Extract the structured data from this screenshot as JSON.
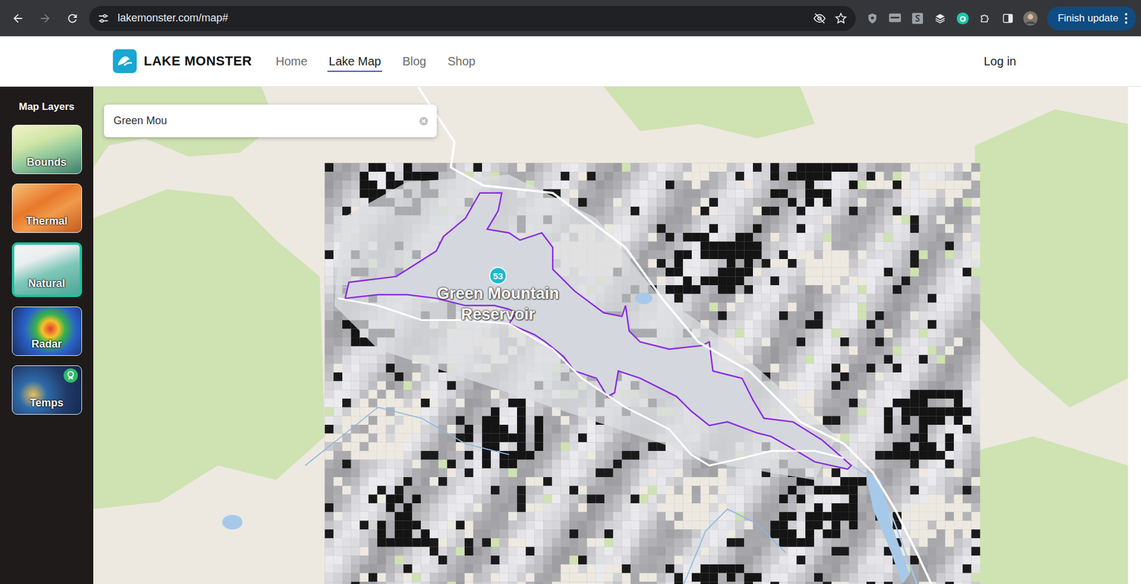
{
  "browser": {
    "url": "lakemonster.com/map#",
    "update_button": "Finish update"
  },
  "site": {
    "logo": "LAKE MONSTER",
    "nav": [
      {
        "label": "Home",
        "selected": false
      },
      {
        "label": "Lake Map",
        "selected": true
      },
      {
        "label": "Blog",
        "selected": false
      },
      {
        "label": "Shop",
        "selected": false
      }
    ],
    "login": "Log in"
  },
  "sidebar": {
    "title": "Map Layers",
    "layers": [
      {
        "label": "Bounds",
        "selected": false
      },
      {
        "label": "Thermal",
        "selected": false
      },
      {
        "label": "Natural",
        "selected": true
      },
      {
        "label": "Radar",
        "selected": false
      },
      {
        "label": "Temps",
        "selected": false
      }
    ]
  },
  "search": {
    "value": "Green Mou"
  },
  "map": {
    "marker": "53",
    "lake_label": "Green Mountain Reservoir"
  }
}
